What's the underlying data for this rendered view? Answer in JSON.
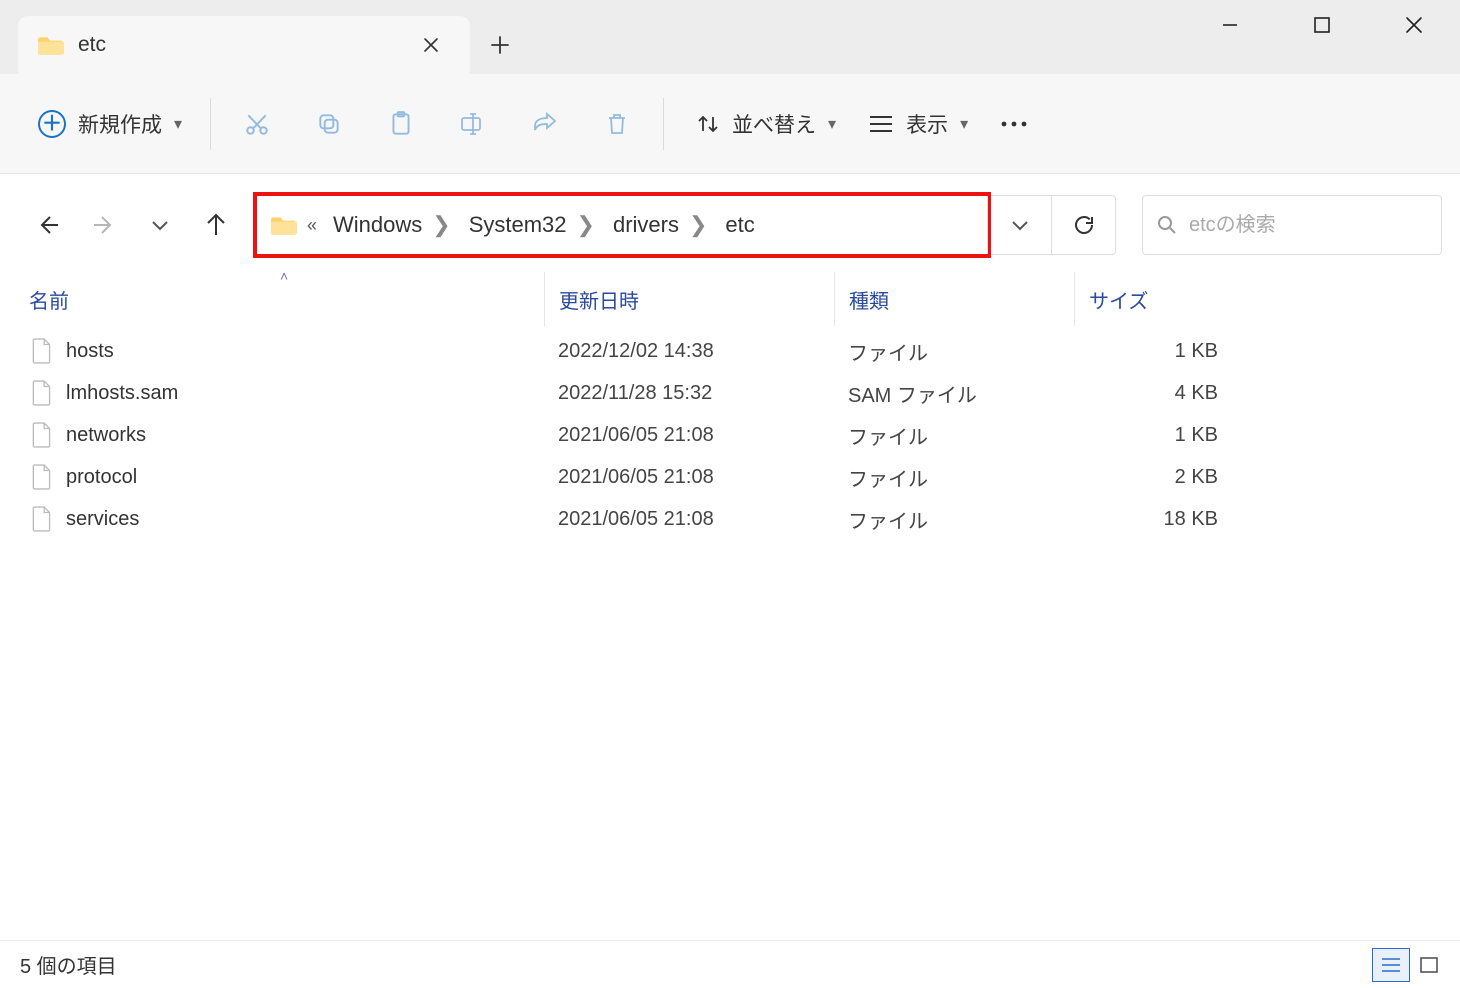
{
  "tab": {
    "title": "etc"
  },
  "toolbar": {
    "new_label": "新規作成",
    "sort_label": "並べ替え",
    "view_label": "表示"
  },
  "breadcrumb": {
    "items": [
      {
        "label": "Windows"
      },
      {
        "label": "System32"
      },
      {
        "label": "drivers"
      },
      {
        "label": "etc"
      }
    ]
  },
  "search": {
    "placeholder": "etcの検索"
  },
  "columns": {
    "name": "名前",
    "date": "更新日時",
    "type": "種類",
    "size": "サイズ"
  },
  "files": [
    {
      "name": "hosts",
      "date": "2022/12/02 14:38",
      "type": "ファイル",
      "size": "1 KB"
    },
    {
      "name": "lmhosts.sam",
      "date": "2022/11/28 15:32",
      "type": "SAM ファイル",
      "size": "4 KB"
    },
    {
      "name": "networks",
      "date": "2021/06/05 21:08",
      "type": "ファイル",
      "size": "1 KB"
    },
    {
      "name": "protocol",
      "date": "2021/06/05 21:08",
      "type": "ファイル",
      "size": "2 KB"
    },
    {
      "name": "services",
      "date": "2021/06/05 21:08",
      "type": "ファイル",
      "size": "18 KB"
    }
  ],
  "status": {
    "count_label": "5 個の項目"
  }
}
